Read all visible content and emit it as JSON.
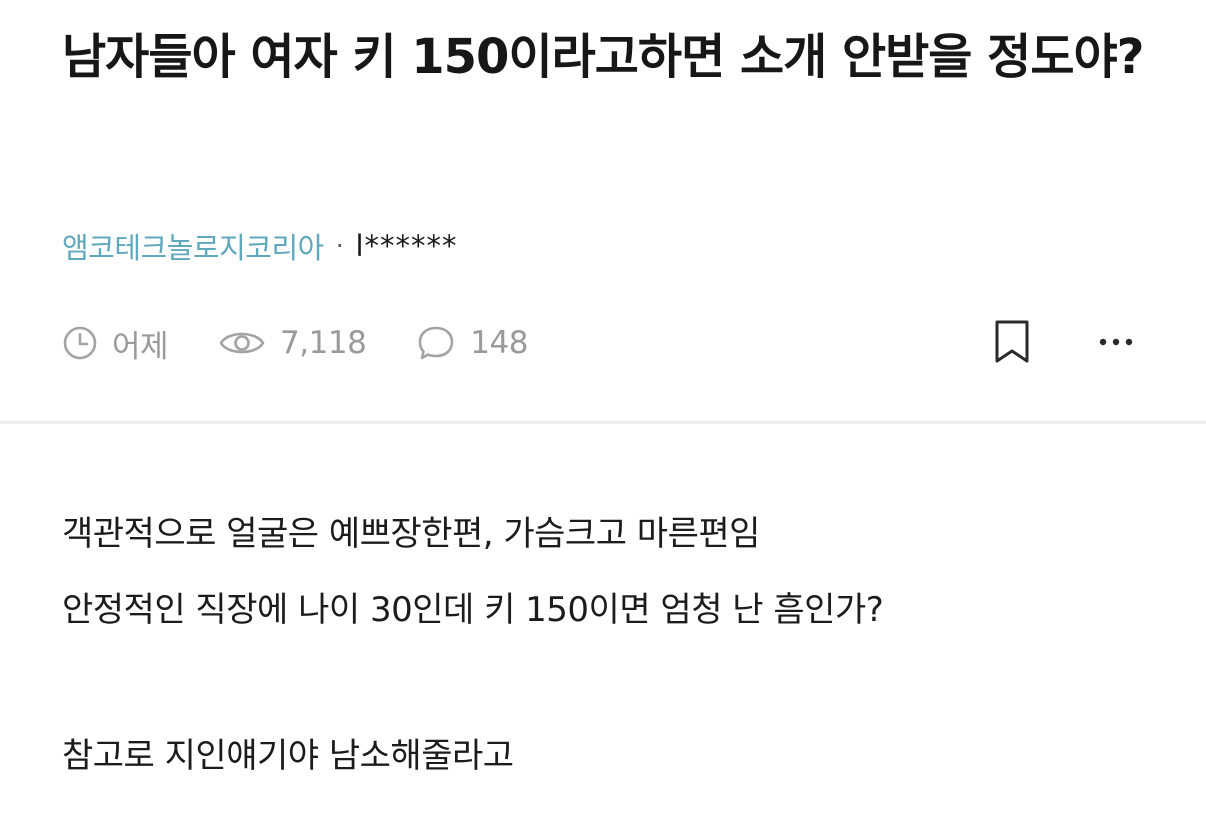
{
  "post": {
    "title": "남자들아 여자 키 150이라고하면 소개 안받을 정도야?",
    "company": "앰코테크놀로지코리아",
    "separator": "·",
    "author": "l******",
    "time": "어제",
    "views": "7,118",
    "comments": "148",
    "body_lines": [
      "객관적으로 얼굴은 예쁘장한편, 가슴크고 마른편임",
      "안정적인 직장에 나이 30인데 키 150이면 엄청 난 흠인가?",
      "참고로 지인얘기야 남소해줄라고"
    ]
  },
  "icons": {
    "time": "clock-icon",
    "views": "eye-icon",
    "comments": "comment-bubble-icon",
    "bookmark": "bookmark-icon",
    "more": "more-horizontal-icon"
  },
  "colors": {
    "company_link": "#5fa8bd",
    "meta_gray": "#9a9a9a",
    "title": "#171717",
    "divider": "#ececec"
  }
}
